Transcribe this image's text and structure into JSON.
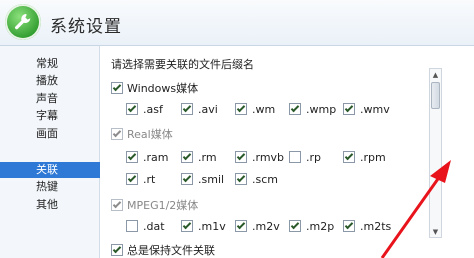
{
  "window": {
    "title": "系统设置"
  },
  "sidebar": {
    "items": [
      {
        "label": "常规"
      },
      {
        "label": "播放"
      },
      {
        "label": "声音"
      },
      {
        "label": "字幕"
      },
      {
        "label": "画面"
      },
      {
        "label": "关联",
        "active": true
      },
      {
        "label": "热键"
      },
      {
        "label": "其他"
      }
    ]
  },
  "main": {
    "prompt": "请选择需要关联的文件后缀名",
    "groups": [
      {
        "label": "Windows媒体",
        "checked": true,
        "items": [
          {
            "label": ".asf",
            "checked": true
          },
          {
            "label": ".avi",
            "checked": true
          },
          {
            "label": ".wm",
            "checked": true
          },
          {
            "label": ".wmp",
            "checked": true
          },
          {
            "label": ".wmv",
            "checked": true
          }
        ]
      },
      {
        "label": "Real媒体",
        "checked": true,
        "muted": true,
        "items": [
          {
            "label": ".ram",
            "checked": true
          },
          {
            "label": ".rm",
            "checked": true
          },
          {
            "label": ".rmvb",
            "checked": true
          },
          {
            "label": ".rp",
            "checked": false
          },
          {
            "label": ".rpm",
            "checked": true
          },
          {
            "label": ".rt",
            "checked": true
          },
          {
            "label": ".smil",
            "checked": true
          },
          {
            "label": ".scm",
            "checked": true
          }
        ]
      },
      {
        "label": "MPEG1/2媒体",
        "checked": true,
        "muted": true,
        "items": [
          {
            "label": ".dat",
            "checked": false
          },
          {
            "label": ".m1v",
            "checked": true
          },
          {
            "label": ".m2v",
            "checked": true
          },
          {
            "label": ".m2p",
            "checked": true
          },
          {
            "label": ".m2ts",
            "checked": true
          }
        ]
      }
    ],
    "always_keep": {
      "label": "总是保持文件关联",
      "checked": true
    }
  },
  "annotation": {
    "color": "#e8131b"
  }
}
